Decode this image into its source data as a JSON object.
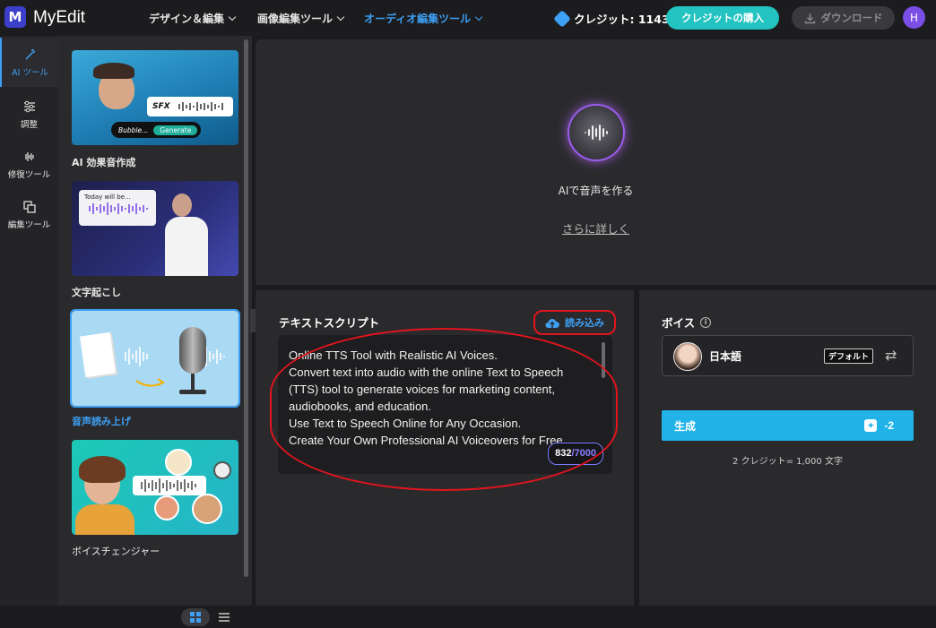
{
  "header": {
    "brand": "MyEdit",
    "nav": [
      "デザイン＆編集",
      "画像編集ツール",
      "オーディオ編集ツール"
    ],
    "credit_label": "クレジット: 1143",
    "buy_label": "クレジットの購入",
    "download_label": "ダウンロード",
    "avatar_initial": "H"
  },
  "rail": {
    "items": [
      {
        "label": "AI ツール",
        "icon": "magic-wand-icon"
      },
      {
        "label": "調整",
        "icon": "sliders-icon"
      },
      {
        "label": "修復ツール",
        "icon": "waveform-icon"
      },
      {
        "label": "編集ツール",
        "icon": "layers-icon"
      }
    ]
  },
  "tools": {
    "cards": [
      {
        "label": "AI 効果音作成",
        "img_sfx": "SFX",
        "img_prompt": "Bubble...",
        "img_button": "Generate"
      },
      {
        "label": "文字起こし",
        "img_text": "Today will be..."
      },
      {
        "label": "音声読み上げ"
      },
      {
        "label": "ボイスチェンジャー"
      }
    ]
  },
  "preview": {
    "title": "AIで音声を作る",
    "more_link": "さらに詳しく"
  },
  "script": {
    "title": "テキストスクリプト",
    "upload_label": "読み込み",
    "lines": [
      "Online TTS Tool with Realistic AI Voices.",
      "Convert text into audio with the online Text to Speech",
      "(TTS) tool to generate voices for marketing content,",
      "audiobooks, and education.",
      "Use Text to Speech Online for Any Occasion.",
      "Create Your Own Professional AI Voiceovers for Free."
    ],
    "char_count": "832",
    "char_max": "/7000"
  },
  "voice": {
    "title": "ボイス",
    "language": "日本語",
    "default_tag": "デフォルト",
    "generate_label": "生成",
    "generate_cost": "-2",
    "rate_note": "2 クレジット= 1,000 文字"
  },
  "colors": {
    "accent": "#3ea0f5",
    "buy": "#22c3c0",
    "generate": "#21b3e8",
    "highlight": "#e0141c"
  }
}
